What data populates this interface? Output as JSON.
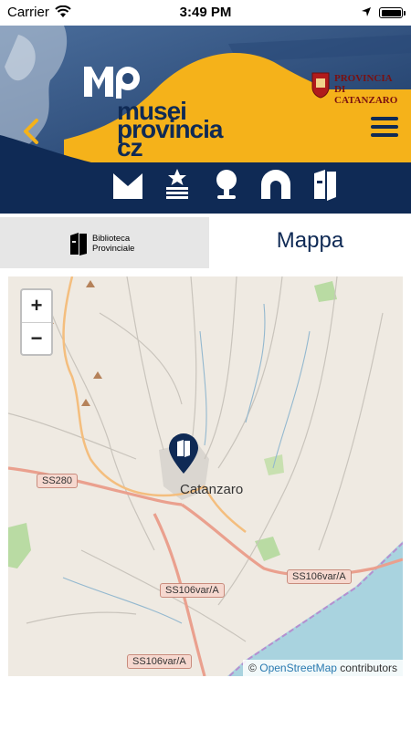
{
  "status_bar": {
    "carrier": "Carrier",
    "time": "3:49 PM"
  },
  "header": {
    "brand_lines": [
      "musei",
      "provincia",
      "cz"
    ],
    "provincia_label_1": "PROVINCIA DI",
    "provincia_label_2": "CATANZARO",
    "colors": {
      "navy": "#0f2a55",
      "yellow": "#f5b21a",
      "photo_blue": "#3a5a8a"
    }
  },
  "nav_icons": [
    "museum-icon",
    "star-stack-icon",
    "tree-icon",
    "arch-icon",
    "library-book-icon"
  ],
  "tabs": {
    "library_label_1": "Biblioteca",
    "library_label_2": "Provinciale",
    "map_title": "Mappa"
  },
  "map": {
    "zoom_in": "+",
    "zoom_out": "−",
    "city": "Catanzaro",
    "roads": [
      "SS280",
      "SS106var/A",
      "SS106var/A",
      "SS106var/A"
    ],
    "attribution_prefix": "©",
    "attribution_link": "OpenStreetMap",
    "attribution_suffix": "contributors"
  }
}
